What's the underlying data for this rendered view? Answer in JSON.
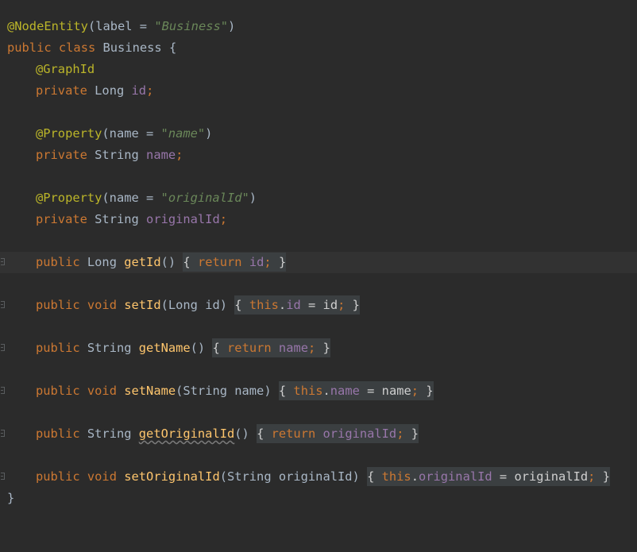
{
  "code": {
    "class_annotation": "@NodeEntity",
    "class_annotation_args": "(label = ",
    "class_annotation_value": "\"Business\"",
    "class_annotation_close": ")",
    "kw_public": "public",
    "kw_class": "class",
    "kw_private": "private",
    "kw_return": "return",
    "kw_void": "void",
    "kw_this": "this",
    "class_name": "Business",
    "brace_open": "{",
    "brace_close": "}",
    "graph_id_annotation": "@GraphId",
    "property_annotation": "@Property",
    "name_arg_open": "(name = ",
    "name_value": "\"name\"",
    "original_id_value": "\"originalId\"",
    "paren_close": ")",
    "type_long": "Long",
    "type_string": "String",
    "field_id": "id",
    "field_name": "name",
    "field_original_id": "originalId",
    "semicolon": ";",
    "method_get_id": "getId",
    "method_set_id": "setId",
    "method_get_name": "getName",
    "method_set_name": "setName",
    "method_get_original_id": "getOriginalId",
    "method_set_original_id": "setOriginalId",
    "empty_parens": "()",
    "param_long_id": "(Long id)",
    "param_string_name": "(String name)",
    "param_string_original_id": "(String originalId)",
    "fold_open": "{ ",
    "fold_close": "}",
    "dot": ".",
    "assign": " = ",
    "param_id": "id",
    "param_name": "name",
    "param_original_id": "originalId"
  }
}
